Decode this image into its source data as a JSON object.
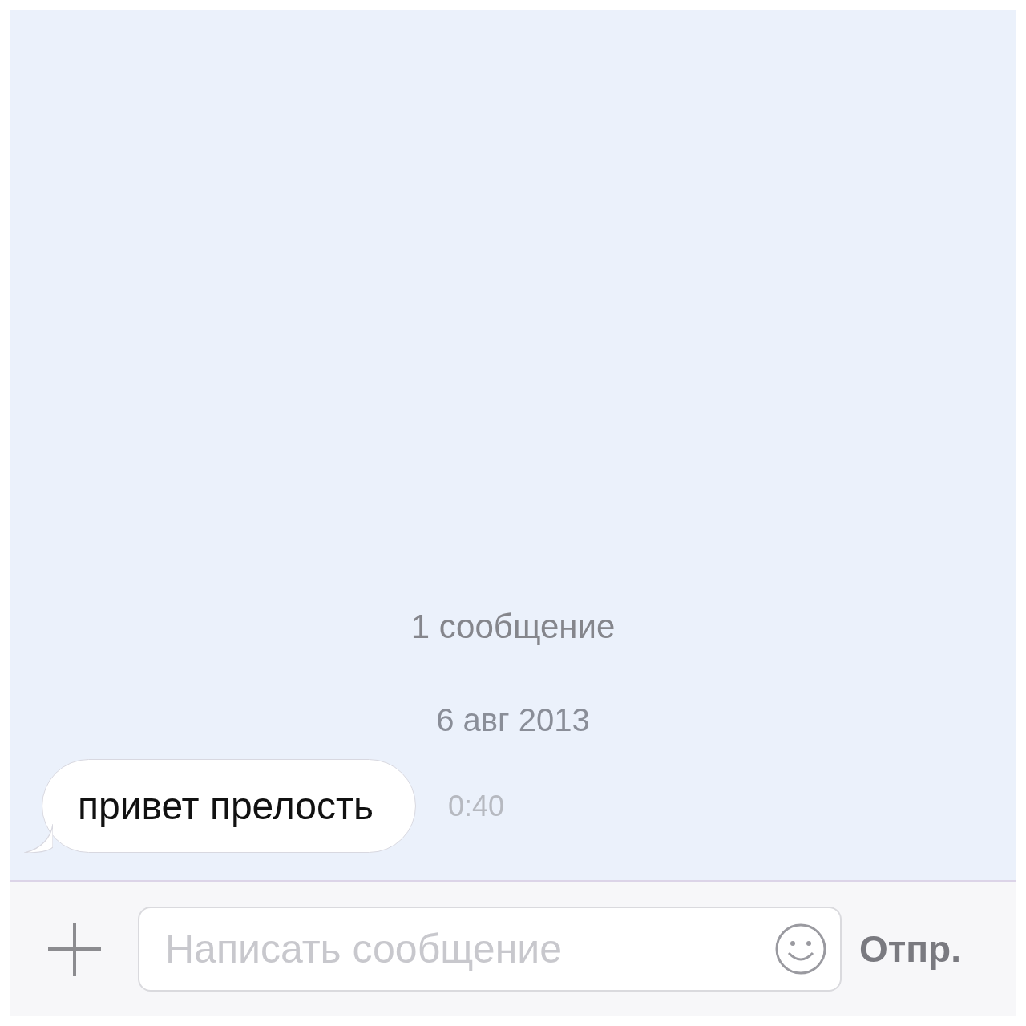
{
  "chat": {
    "message_count": "1 сообщение",
    "date": "6 авг 2013",
    "messages": [
      {
        "text": "привет прелость",
        "time": "0:40"
      }
    ]
  },
  "composer": {
    "placeholder": "Написать сообщение",
    "send_label": "Отпр."
  }
}
